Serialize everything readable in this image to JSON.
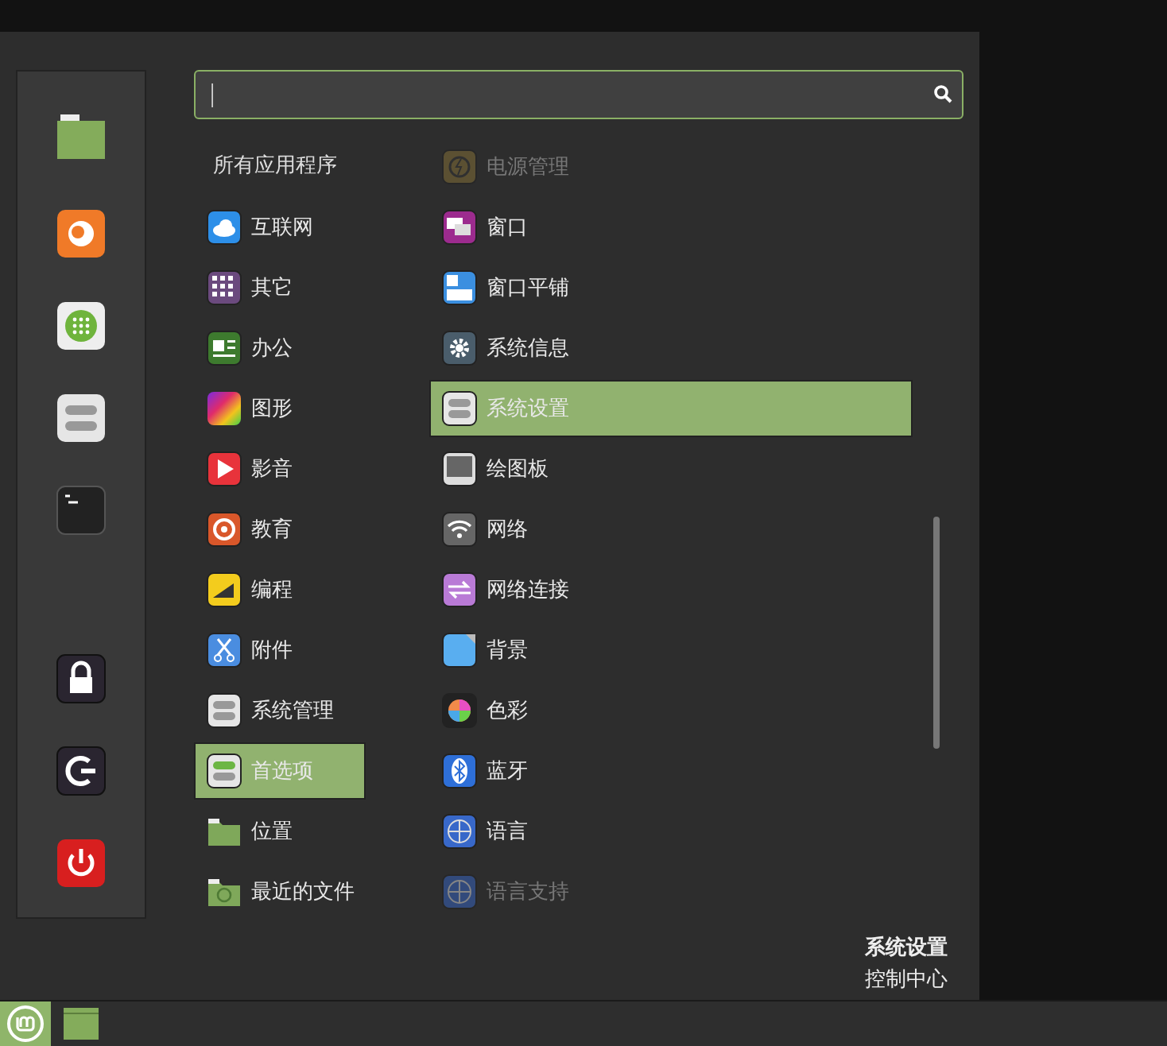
{
  "search": {
    "cursor": "|"
  },
  "categories_header": "所有应用程序",
  "categories": [
    {
      "label": "互联网",
      "selected": false
    },
    {
      "label": "其它",
      "selected": false
    },
    {
      "label": "办公",
      "selected": false
    },
    {
      "label": "图形",
      "selected": false
    },
    {
      "label": "影音",
      "selected": false
    },
    {
      "label": "教育",
      "selected": false
    },
    {
      "label": "编程",
      "selected": false
    },
    {
      "label": "附件",
      "selected": false
    },
    {
      "label": "系统管理",
      "selected": false
    },
    {
      "label": "首选项",
      "selected": true
    },
    {
      "label": "位置",
      "selected": false
    },
    {
      "label": "最近的文件",
      "selected": false
    }
  ],
  "apps": [
    {
      "label": "电源管理",
      "selected": false,
      "disabled": true
    },
    {
      "label": "窗口",
      "selected": false,
      "disabled": false
    },
    {
      "label": "窗口平铺",
      "selected": false,
      "disabled": false
    },
    {
      "label": "系统信息",
      "selected": false,
      "disabled": false
    },
    {
      "label": "系统设置",
      "selected": true,
      "disabled": false
    },
    {
      "label": "绘图板",
      "selected": false,
      "disabled": false
    },
    {
      "label": "网络",
      "selected": false,
      "disabled": false
    },
    {
      "label": "网络连接",
      "selected": false,
      "disabled": false
    },
    {
      "label": "背景",
      "selected": false,
      "disabled": false
    },
    {
      "label": "色彩",
      "selected": false,
      "disabled": false
    },
    {
      "label": "蓝牙",
      "selected": false,
      "disabled": false
    },
    {
      "label": "语言",
      "selected": false,
      "disabled": false
    },
    {
      "label": "语言支持",
      "selected": false,
      "disabled": true
    }
  ],
  "description": {
    "title": "系统设置",
    "subtitle": "控制中心"
  }
}
